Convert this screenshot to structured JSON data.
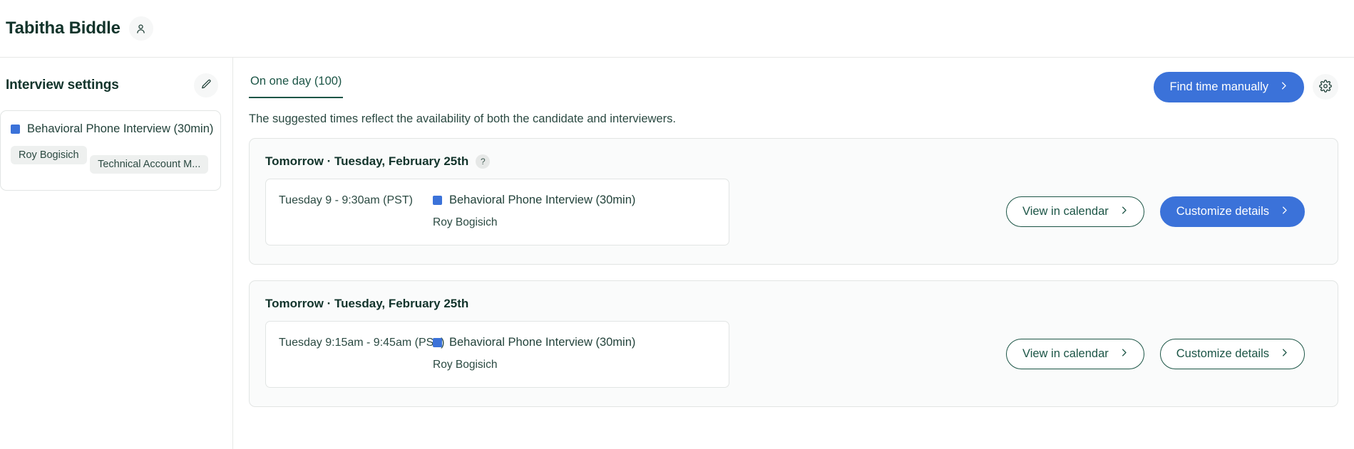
{
  "header": {
    "candidate_name": "Tabitha Biddle",
    "profile_icon": "person-icon"
  },
  "sidebar": {
    "title": "Interview settings",
    "edit_icon": "pencil-icon",
    "interview": {
      "color": "#3b72d9",
      "label": "Behavioral Phone Interview (30min)",
      "tags": [
        "Roy Bogisich",
        "Technical Account M..."
      ]
    }
  },
  "main": {
    "tabs": [
      {
        "label": "On one day (100)",
        "active": true
      }
    ],
    "find_time_button": {
      "label": "Find time manually",
      "icon": "chevron-right-icon",
      "color": "#3b72d9"
    },
    "settings_icon": "gear-icon",
    "subtitle": "The suggested times reflect the availability of both the candidate and interviewers.",
    "cards": [
      {
        "date": "Tomorrow · Tuesday, February 25th",
        "help_badge": "?",
        "has_help_badge": true,
        "slot": {
          "time": "Tuesday 9 - 9:30am (PST)",
          "color": "#3b72d9",
          "title": "Behavioral Phone Interview (30min)",
          "interviewer": "Roy Bogisich"
        },
        "actions": [
          {
            "label": "View in calendar",
            "style": "outline",
            "icon": "chevron-right-icon"
          },
          {
            "label": "Customize details",
            "style": "primary",
            "icon": "chevron-right-icon"
          }
        ]
      },
      {
        "date": "Tomorrow · Tuesday, February 25th",
        "help_badge": "",
        "has_help_badge": false,
        "slot": {
          "time": "Tuesday 9:15am - 9:45am (PST)",
          "color": "#3b72d9",
          "title": "Behavioral Phone Interview (30min)",
          "interviewer": "Roy Bogisich"
        },
        "actions": [
          {
            "label": "View in calendar",
            "style": "outline",
            "icon": "chevron-right-icon"
          },
          {
            "label": "Customize details",
            "style": "outline",
            "icon": "chevron-right-icon"
          }
        ]
      }
    ]
  },
  "colors": {
    "accent_blue": "#3b72d9",
    "brand_green": "#1c5546",
    "text_dark": "#12342b",
    "tag_bg": "#eef0ef",
    "card_bg": "#fafbfb",
    "border": "#e2e5e4"
  }
}
